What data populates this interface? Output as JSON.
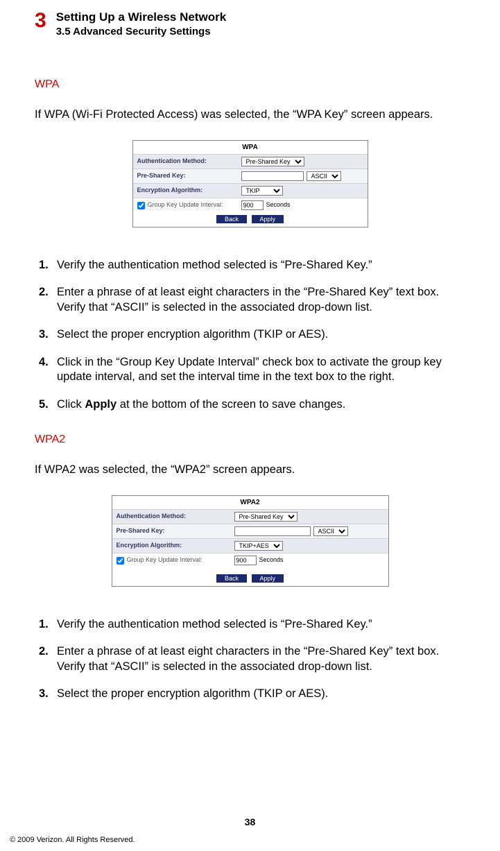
{
  "header": {
    "chapter_number": "3",
    "chapter_title": "Setting Up a Wireless Network",
    "section_title": "3.5  Advanced Security Settings"
  },
  "wpa": {
    "heading": "WPA",
    "intro": "If WPA (Wi-Fi Protected Access) was selected, the “WPA Key” screen appears.",
    "panel": {
      "title": "WPA",
      "auth_label": "Authentication Method:",
      "auth_value": "Pre-Shared Key",
      "psk_label": "Pre-Shared Key:",
      "psk_value": "",
      "psk_encoding": "ASCII",
      "enc_label": "Encryption Algorithm:",
      "enc_value": "TKIP",
      "gkui_label": "Group Key Update Interval:",
      "gkui_value": "900",
      "gkui_unit": "Seconds",
      "back_btn": "Back",
      "apply_btn": "Apply"
    },
    "steps": [
      "Verify the authentication method selected is “Pre-Shared Key.”",
      "Enter a phrase of at least eight characters in the “Pre-Shared Key” text box. Verify that “ASCII” is selected in the associated drop-down list.",
      "Select the proper encryption algorithm (TKIP or AES).",
      "Click in the “Group Key Update Interval” check box to activate the group key update interval, and set the interval time in the text box to the right.",
      "Click Apply at the bottom of the screen to save changes."
    ]
  },
  "wpa2": {
    "heading": "WPA2",
    "intro": "If WPA2  was selected, the “WPA2” screen appears.",
    "panel": {
      "title": "WPA2",
      "auth_label": "Authentication Method:",
      "auth_value": "Pre-Shared Key",
      "psk_label": "Pre-Shared Key:",
      "psk_value": "",
      "psk_encoding": "ASCII",
      "enc_label": "Encryption Algorithm:",
      "enc_value": "TKIP+AES",
      "gkui_label": "Group Key Update Interval:",
      "gkui_value": "900",
      "gkui_unit": "Seconds",
      "back_btn": "Back",
      "apply_btn": "Apply"
    },
    "steps": [
      "Verify the authentication method selected is “Pre-Shared Key.”",
      "Enter a phrase of at least eight characters in the “Pre-Shared Key” text box. Verify that “ASCII” is selected in the associated drop-down list.",
      "Select the proper encryption algorithm (TKIP or AES)."
    ]
  },
  "step5_bold_word": "Apply",
  "step5_pre": "Click ",
  "step5_post": " at the bottom of the screen to save changes.",
  "page_number": "38",
  "copyright": "© 2009 Verizon. All Rights Reserved."
}
